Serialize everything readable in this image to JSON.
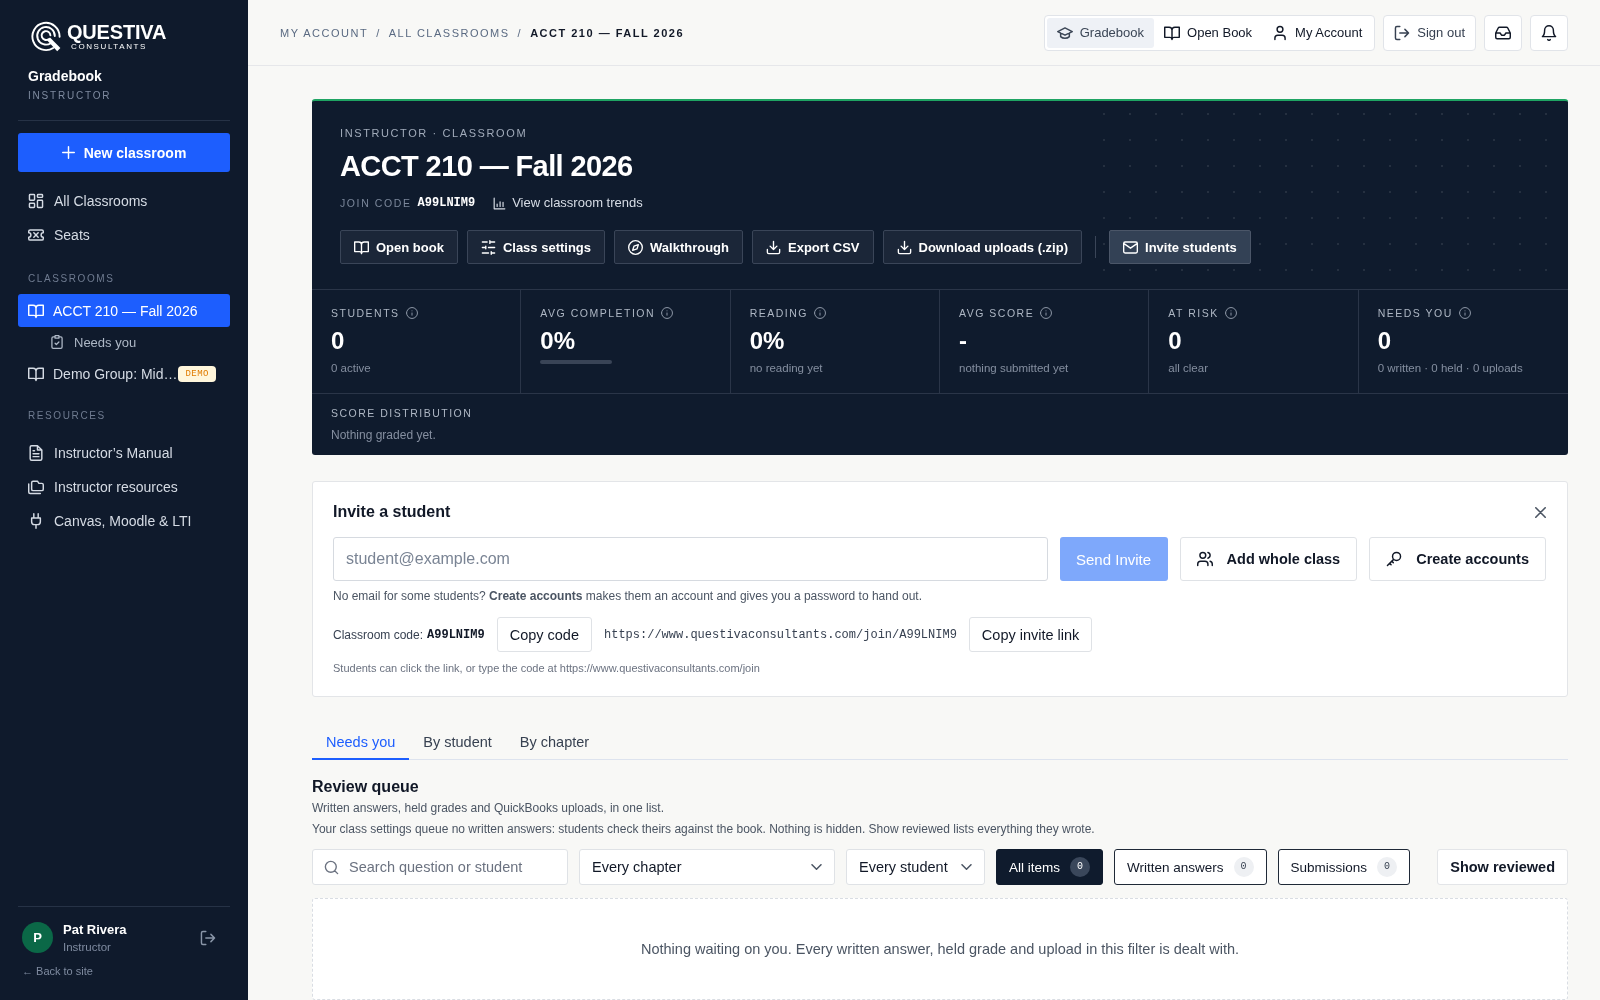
{
  "sidebar": {
    "brand": {
      "name": "QUESTIVA",
      "tagline": "CONSULTANTS"
    },
    "app": "Gradebook",
    "role": "INSTRUCTOR",
    "new_button": "New classroom",
    "nav": [
      "All Classrooms",
      "Seats"
    ],
    "classrooms": {
      "heading": "CLASSROOMS",
      "items": [
        {
          "label": "ACCT 210 — Fall 2026",
          "selected": true,
          "children": [
            {
              "label": "Needs you",
              "selected": false
            }
          ]
        },
        {
          "label": "Demo Group: Mid…",
          "selected": false,
          "badge": "DEMO"
        }
      ]
    },
    "resources": {
      "heading": "RESOURCES",
      "items": [
        "Instructor’s Manual",
        "Instructor resources",
        "Canvas, Moodle & LTI"
      ]
    },
    "user": {
      "initial": "P",
      "name": "Pat Rivera",
      "role": "Instructor"
    },
    "back_link": "← Back to site"
  },
  "topbar": {
    "breadcrumb": [
      "MY ACCOUNT",
      "ALL CLASSROOMS",
      "ACCT 210 — FALL 2026"
    ],
    "separator": "/",
    "nav": [
      {
        "label": "Gradebook",
        "selected": true
      },
      {
        "label": "Open Book",
        "selected": false
      },
      {
        "label": "My Account",
        "selected": false
      }
    ],
    "sign_out": "Sign out"
  },
  "classroom": {
    "eyebrow": "INSTRUCTOR · CLASSROOM",
    "title": "ACCT 210 — Fall 2026",
    "join_label": "JOIN CODE",
    "join_code": "A99LNIM9",
    "trends_link": "View classroom trends",
    "actions": [
      "Open book",
      "Class settings",
      "Walkthrough",
      "Export CSV",
      "Download uploads (.zip)"
    ],
    "invite_button": "Invite students",
    "stats": [
      {
        "kind": "number",
        "label": "STUDENTS",
        "value": "0",
        "note": "0 active"
      },
      {
        "kind": "progress",
        "label": "AVG COMPLETION",
        "value": "0%",
        "level": 0
      },
      {
        "kind": "number",
        "label": "READING",
        "value": "0%",
        "note": "no reading yet"
      },
      {
        "kind": "number",
        "label": "AVG SCORE",
        "value": "-",
        "note": "nothing submitted yet"
      },
      {
        "kind": "number",
        "label": "AT RISK",
        "value": "0",
        "note": "all clear"
      },
      {
        "kind": "number",
        "label": "NEEDS YOU",
        "value": "0",
        "note": "0 written · 0 held · 0 uploads"
      }
    ],
    "distribution": {
      "label": "SCORE DISTRIBUTION",
      "note": "Nothing graded yet."
    }
  },
  "invite": {
    "title": "Invite a student",
    "email": {
      "placeholder": "student@example.com"
    },
    "send_button": {
      "label": "Send Invite",
      "disabled": true
    },
    "add_class_button": "Add whole class",
    "create_button": "Create accounts",
    "help": "No email for some students? **Create accounts** makes them an account and gives you a password to hand out.",
    "code_label": "Classroom code:",
    "code": "A99LNIM9",
    "copy_code_button": "Copy code",
    "invite_link": "https://www.questivaconsultants.com/join/A99LNIM9",
    "copy_link_button": "Copy invite link",
    "footnote": "Students can click the link, or type the code at https://www.questivaconsultants.com/join"
  },
  "tabs": [
    {
      "label": "Needs you",
      "selected": true
    },
    {
      "label": "By student",
      "selected": false
    },
    {
      "label": "By chapter",
      "selected": false
    }
  ],
  "review": {
    "title": "Review queue",
    "lines": [
      "Written answers, held grades and QuickBooks uploads, in one list.",
      "Your class settings queue no written answers: students check theirs against the book. Nothing is hidden. Show reviewed lists everything they wrote."
    ],
    "search": {
      "placeholder": "Search question or student"
    },
    "selects": [
      {
        "value": "Every chapter"
      },
      {
        "value": "Every student"
      }
    ],
    "filters": [
      {
        "label": "All items",
        "count": "0",
        "selected": true
      },
      {
        "label": "Written answers",
        "count": "0",
        "selected": false
      },
      {
        "label": "Submissions",
        "count": "0",
        "selected": false
      }
    ],
    "show_reviewed": "Show reviewed",
    "empty": "Nothing waiting on you. Every written answer, held grade and upload in this filter is dealt with."
  }
}
